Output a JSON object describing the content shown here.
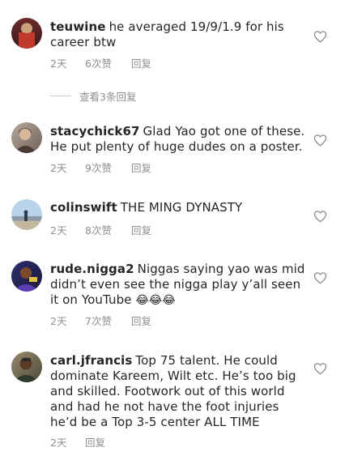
{
  "view_replies_label": "查看3条回复",
  "comments": [
    {
      "username": "teuwine",
      "text": "he averaged 19/9/1.9 for his career btw",
      "time": "2天",
      "likes": "6次赞",
      "reply": "回复"
    },
    {
      "username": "stacychick67",
      "text": "Glad Yao got one of these. He put plenty of huge dudes on a poster.",
      "time": "2天",
      "likes": "9次赞",
      "reply": "回复"
    },
    {
      "username": "colinswift",
      "text": "THE MING DYNASTY",
      "time": "2天",
      "likes": "8次赞",
      "reply": "回复"
    },
    {
      "username": "rude.nigga2",
      "text": "Niggas saying yao was mid didn’t even see the nigga play y’all seen it on YouTube",
      "emoji": "😂😂😂",
      "time": "2天",
      "likes": "7次赞",
      "reply": "回复"
    },
    {
      "username": "carl.jfrancis",
      "text": "Top 75 talent. He could dominate Kareem, Wilt etc. He’s too big and skilled. Footwork out of this world and had he not have the foot injuries he’d be a Top 3-5 center ALL TIME",
      "time": "2天",
      "likes": "",
      "reply": "回复"
    }
  ]
}
